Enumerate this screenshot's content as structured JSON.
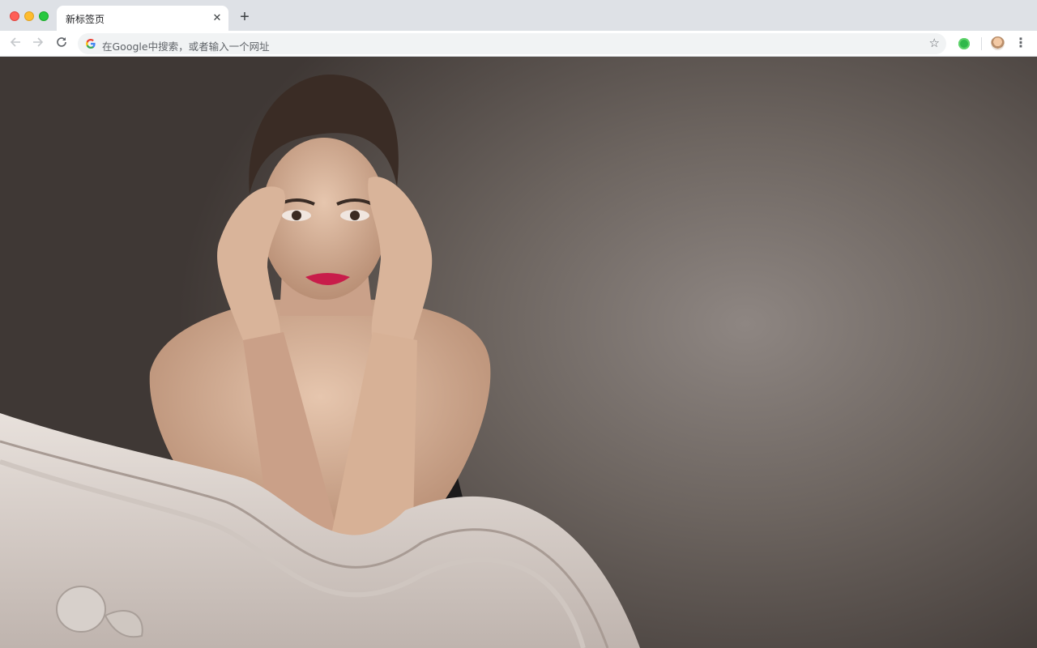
{
  "window": {
    "controls": [
      "close",
      "minimize",
      "maximize"
    ]
  },
  "tabs": [
    {
      "title": "新标签页",
      "active": true
    }
  ],
  "toolbar": {
    "omnibox_placeholder": "在Google中搜索，或者输入一个网址",
    "icons": [
      "back-icon",
      "forward-icon",
      "reload-icon",
      "google-icon",
      "star-icon",
      "extension-icon",
      "avatar",
      "menu-icon"
    ]
  },
  "content": {
    "type": "wallpaper photo",
    "colors": {
      "background": "#6d6560",
      "bed_frame": "#d9d1cc",
      "skin": "#d9b49a",
      "hair": "#3a2c25"
    }
  }
}
